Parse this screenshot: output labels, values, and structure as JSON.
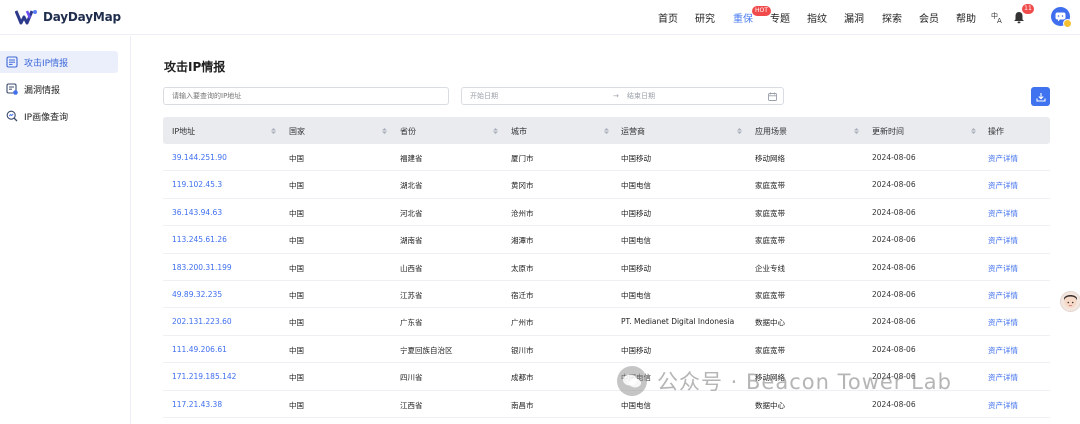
{
  "app": {
    "logo_text": "DayDayMap"
  },
  "nav": {
    "items": [
      "首页",
      "研究",
      "重保",
      "专题",
      "指纹",
      "漏洞",
      "探索",
      "会员",
      "帮助"
    ],
    "hot_badge": "HOT",
    "notification_count": "11"
  },
  "sidebar": {
    "items": [
      {
        "label": "攻击IP情报",
        "icon": "document-list-icon",
        "active": true
      },
      {
        "label": "漏洞情报",
        "icon": "bug-report-icon",
        "active": false
      },
      {
        "label": "IP画像查询",
        "icon": "search-profile-icon",
        "active": false
      }
    ]
  },
  "main": {
    "title": "攻击IP情报",
    "search_placeholder": "请输入要查询的IP地址",
    "date_start_placeholder": "开始日期",
    "date_arrow": "→",
    "date_end_placeholder": "结束日期"
  },
  "table": {
    "headers": [
      "IP地址",
      "国家",
      "省份",
      "城市",
      "运营商",
      "应用场景",
      "更新时间",
      "操作"
    ],
    "rows": [
      [
        "39.144.251.90",
        "中国",
        "福建省",
        "厦门市",
        "中国移动",
        "移动网络",
        "2024-08-06",
        "资产详情"
      ],
      [
        "119.102.45.3",
        "中国",
        "湖北省",
        "黄冈市",
        "中国电信",
        "家庭宽带",
        "2024-08-06",
        "资产详情"
      ],
      [
        "36.143.94.63",
        "中国",
        "河北省",
        "沧州市",
        "中国移动",
        "家庭宽带",
        "2024-08-06",
        "资产详情"
      ],
      [
        "113.245.61.26",
        "中国",
        "湖南省",
        "湘潭市",
        "中国电信",
        "家庭宽带",
        "2024-08-06",
        "资产详情"
      ],
      [
        "183.200.31.199",
        "中国",
        "山西省",
        "太原市",
        "中国移动",
        "企业专线",
        "2024-08-06",
        "资产详情"
      ],
      [
        "49.89.32.235",
        "中国",
        "江苏省",
        "宿迁市",
        "中国电信",
        "家庭宽带",
        "2024-08-06",
        "资产详情"
      ],
      [
        "202.131.223.60",
        "中国",
        "广东省",
        "广州市",
        "PT. Medianet Digital Indonesia",
        "数据中心",
        "2024-08-06",
        "资产详情"
      ],
      [
        "111.49.206.61",
        "中国",
        "宁夏回族自治区",
        "银川市",
        "中国移动",
        "家庭宽带",
        "2024-08-06",
        "资产详情"
      ],
      [
        "171.219.185.142",
        "中国",
        "四川省",
        "成都市",
        "中国电信",
        "移动网络",
        "2024-08-06",
        "资产详情"
      ],
      [
        "117.21.43.38",
        "中国",
        "江西省",
        "南昌市",
        "中国电信",
        "数据中心",
        "2024-08-06",
        "资产详情"
      ]
    ]
  },
  "watermark": {
    "text": "公众号 · Beacon Tower Lab"
  },
  "colors": {
    "accent": "#3f6fef",
    "hot": "#f04a4a",
    "header_bg": "#e9ebef",
    "active_bg": "#ebeffc"
  }
}
